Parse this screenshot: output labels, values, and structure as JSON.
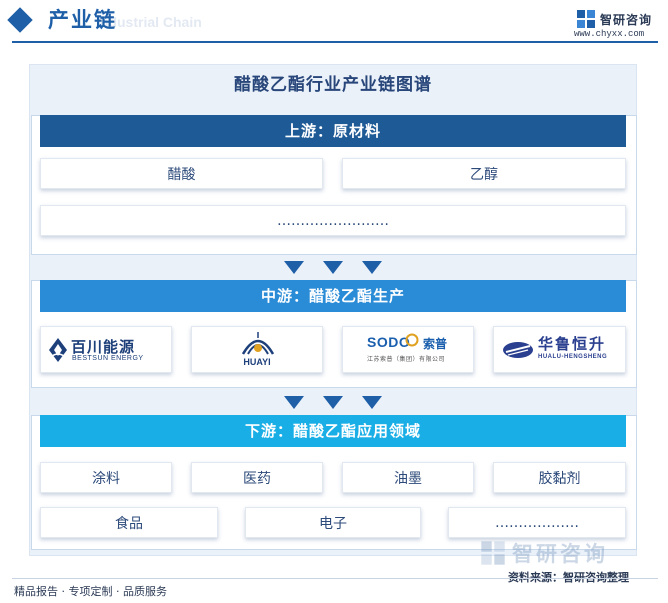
{
  "header": {
    "title": "产业链",
    "subtitle": "Industrial Chain",
    "brand_name": "智研咨询",
    "brand_url": "www.chyxx.com"
  },
  "diagram": {
    "title": "醋酸乙酯行业产业链图谱",
    "upstream": {
      "heading": "上游：原材料",
      "items": [
        "醋酸",
        "乙醇",
        "……………………"
      ]
    },
    "midstream": {
      "heading": "中游：醋酸乙酯生产",
      "companies": [
        {
          "name": "百川能源",
          "en": "BESTSUN ENERGY"
        },
        {
          "name": "HUAYI"
        },
        {
          "name": "SODO",
          "name_cn": "索普",
          "sub": "江苏索普（集团）有限公司"
        },
        {
          "name": "华鲁恒升",
          "en": "HUALU-HENGSHENG"
        }
      ]
    },
    "downstream": {
      "heading": "下游：醋酸乙酯应用领域",
      "row1": [
        "涂料",
        "医药",
        "油墨",
        "胶黏剂"
      ],
      "row2": [
        "食品",
        "电子",
        "………………"
      ]
    }
  },
  "footer": {
    "left": "精品报告 · 专项定制 · 品质服务",
    "source": "资料来源：智研咨询整理",
    "watermark": "智研咨询"
  },
  "colors": {
    "upstream": "#1e5a96",
    "midstream": "#2a8bd6",
    "downstream": "#1aaee6",
    "accent": "#1e5fa8"
  }
}
